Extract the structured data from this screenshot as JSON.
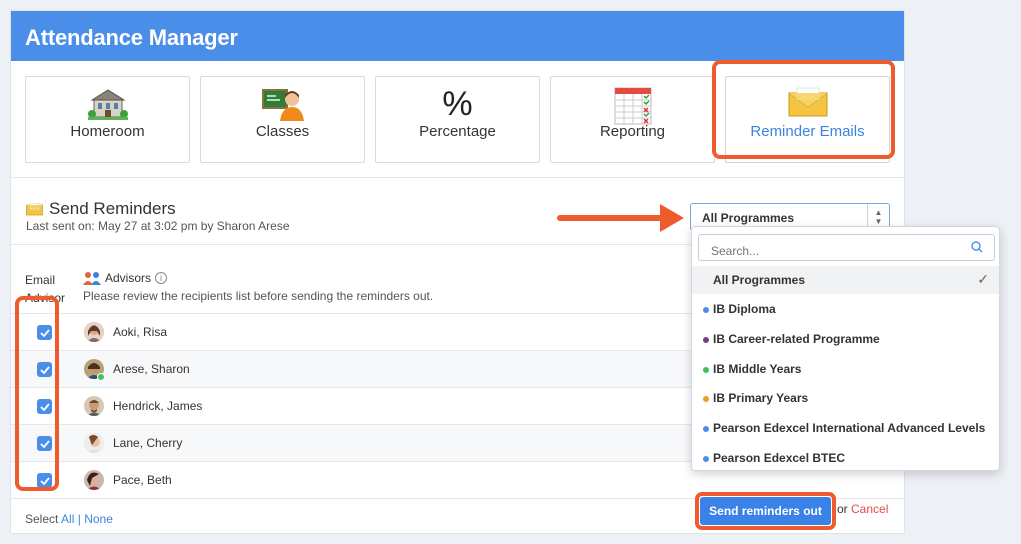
{
  "app": {
    "title": "Attendance Manager"
  },
  "tiles": [
    {
      "label": "Homeroom",
      "icon": "homeroom-building-icon"
    },
    {
      "label": "Classes",
      "icon": "classes-teacher-icon"
    },
    {
      "label": "Percentage",
      "icon": "percentage-icon"
    },
    {
      "label": "Reporting",
      "icon": "reporting-spreadsheet-icon"
    },
    {
      "label": "Reminder Emails",
      "icon": "envelope-icon",
      "active": true
    }
  ],
  "section": {
    "title": "Send Reminders",
    "last_sent": "Last sent on: May 27 at 3:02 pm by Sharon Arese"
  },
  "filter": {
    "selected": "All Programmes"
  },
  "columns": {
    "email_line1": "Email",
    "email_line2": "Advisor",
    "advisors": "Advisors",
    "note": "Please review the recipients list before sending the reminders out."
  },
  "advisors": [
    {
      "name": "Aoki, Risa",
      "checked": true
    },
    {
      "name": "Arese, Sharon",
      "checked": true,
      "online": true
    },
    {
      "name": "Hendrick, James",
      "checked": true
    },
    {
      "name": "Lane, Cherry",
      "checked": true
    },
    {
      "name": "Pace, Beth",
      "checked": true
    }
  ],
  "footer": {
    "select_label": "Select",
    "all": "All",
    "separator": "|",
    "none": "None"
  },
  "actions": {
    "send": "Send reminders out",
    "or": "or",
    "cancel": "Cancel"
  },
  "dropdown": {
    "search_placeholder": "Search...",
    "options": [
      {
        "label": "All Programmes",
        "selected": true
      },
      {
        "label": "IB Diploma",
        "color": "#4a8eea"
      },
      {
        "label": "IB Career-related Programme",
        "color": "#7b3a8c"
      },
      {
        "label": "IB Middle Years",
        "color": "#3cc45a"
      },
      {
        "label": "IB Primary Years",
        "color": "#f0a020"
      },
      {
        "label": "Pearson Edexcel International Advanced Levels",
        "color": "#4a8eea"
      },
      {
        "label": "Pearson Edexcel BTEC",
        "color": "#4a8eea"
      }
    ]
  },
  "colors": {
    "header": "#4a8eea",
    "highlight": "#ee5b2d",
    "link": "#3a84df",
    "cancel": "#e34a4a"
  }
}
